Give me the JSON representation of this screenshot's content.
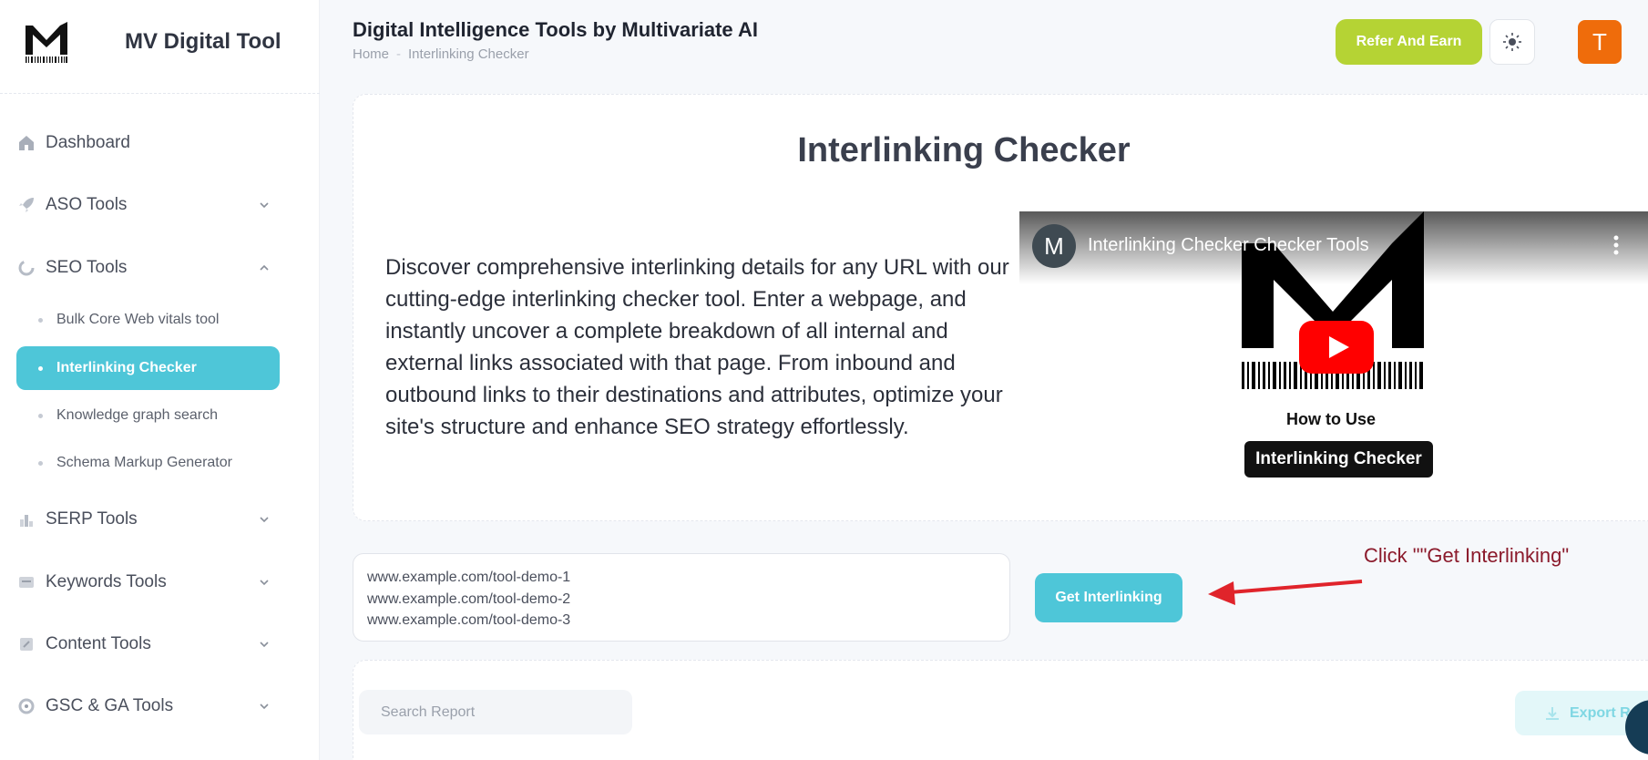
{
  "brand": {
    "title": "MV Digital Tool"
  },
  "sidebar": {
    "items": [
      {
        "label": "Dashboard",
        "icon": "home-icon"
      },
      {
        "label": "ASO Tools",
        "icon": "rocket-icon"
      },
      {
        "label": "SEO Tools",
        "icon": "seo-circle-icon"
      },
      {
        "label": "SERP Tools",
        "icon": "serp-icon"
      },
      {
        "label": "Keywords Tools",
        "icon": "keywords-icon"
      },
      {
        "label": "Content Tools",
        "icon": "content-icon"
      },
      {
        "label": "GSC & GA Tools",
        "icon": "analytics-icon"
      }
    ],
    "seo_sub": [
      {
        "label": "Bulk Core Web vitals tool"
      },
      {
        "label": "Interlinking Checker"
      },
      {
        "label": "Knowledge graph search"
      },
      {
        "label": "Schema Markup Generator"
      }
    ]
  },
  "header": {
    "title": "Digital Intelligence Tools by Multivariate AI",
    "breadcrumb_home": "Home",
    "breadcrumb_sep": "-",
    "breadcrumb_current": "Interlinking Checker",
    "refer_label": "Refer And Earn",
    "avatar_initial": "T"
  },
  "card": {
    "title": "Interlinking Checker",
    "description": "Discover comprehensive interlinking details for any URL with our cutting-edge interlinking checker tool. Enter a webpage, and instantly uncover a complete breakdown of all internal and external links associated with that page. From inbound and outbound links to their destinations and attributes, optimize your site's structure and enhance SEO strategy effortlessly."
  },
  "video": {
    "channel_initial": "M",
    "title": "Interlinking Checker Checker Tools",
    "how_to": "How to Use",
    "pill": "Interlinking Checker"
  },
  "input": {
    "lines": [
      "www.example.com/tool-demo-1",
      "www.example.com/tool-demo-2",
      "www.example.com/tool-demo-3"
    ]
  },
  "get_button": "Get Interlinking",
  "annotation": "Click \"\"Get Interlinking\"",
  "report": {
    "search_placeholder": "Search Report",
    "export_label": "Export Re"
  },
  "colors": {
    "accent": "#4ec6d8",
    "refer": "#b5d334",
    "avatar": "#ef6c0b",
    "annotation": "#8b1a2b",
    "arrow": "#e0242b"
  }
}
